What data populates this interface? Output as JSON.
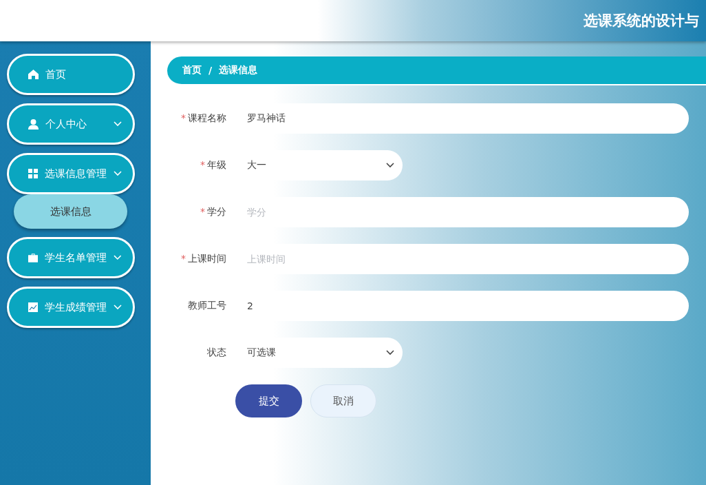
{
  "header": {
    "title": "选课系统的设计与"
  },
  "sidebar": {
    "items": [
      {
        "label": "首页",
        "kind": "link"
      },
      {
        "label": "个人中心",
        "kind": "menu"
      },
      {
        "label": "选课信息管理",
        "kind": "menu",
        "children": [
          {
            "label": "选课信息",
            "selected": true
          }
        ]
      },
      {
        "label": "学生名单管理",
        "kind": "menu"
      },
      {
        "label": "学生成绩管理",
        "kind": "menu"
      }
    ]
  },
  "breadcrumb": {
    "items": [
      "首页",
      "选课信息"
    ],
    "separator": "/"
  },
  "form": {
    "fields": [
      {
        "label": "课程名称",
        "required_mark": "*",
        "kind": "text",
        "value": "罗马神话"
      },
      {
        "label": "年级",
        "required_mark": "*",
        "kind": "select",
        "value": "大一"
      },
      {
        "label": "学分",
        "required_mark": "*",
        "kind": "text",
        "placeholder": "学分"
      },
      {
        "label": "上课时间",
        "required_mark": "*",
        "kind": "text",
        "placeholder": "上课时间"
      },
      {
        "label": "教师工号",
        "kind": "text",
        "value": "2"
      },
      {
        "label": "状态",
        "kind": "select",
        "value": "可选课"
      }
    ],
    "buttons": [
      {
        "label": "提交",
        "kind": "primary"
      },
      {
        "label": "取消",
        "kind": "secondary"
      }
    ]
  }
}
